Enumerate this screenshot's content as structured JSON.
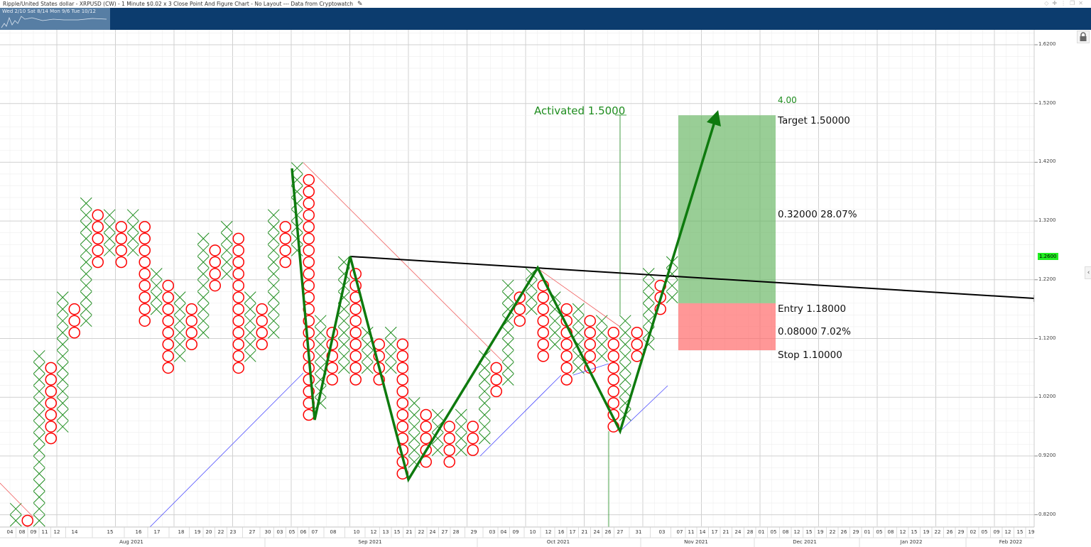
{
  "header": {
    "title": "Ripple/United States dollar - XRPUSD (CW) - 1 Minute $0.02 x 3 Close Point And Figure Chart - No Layout --- Data from Cryptowatch",
    "edit_icon": "pencil-icon",
    "window_icons": [
      "diamond-icon",
      "pin-icon",
      "info-icon",
      "restore-icon",
      "close-icon"
    ]
  },
  "navigator": {
    "dates": "Wed 2/10  Sat 8/14  Mon 9/6  Tue 10/12"
  },
  "colors": {
    "x_color": "#1e8c1e",
    "o_color": "#ff0000",
    "trend_color": "#0e7a0e",
    "target_fill": "#62b35e",
    "stop_fill": "#ff6b6b",
    "last_price_bg": "#22ee22"
  },
  "annotations": {
    "activated": "Activated 1.5000",
    "ratio": "4.00",
    "target": "Target  1.50000",
    "reward": "0.32000  28.07%",
    "entry": "Entry  1.18000",
    "risk": "0.08000  7.02%",
    "stop": "Stop  1.10000"
  },
  "last_price": "1.2600",
  "chart_data": {
    "type": "scatter",
    "subtype": "point_and_figure",
    "title": "XRPUSD $0.02 x 3 Close Point And Figure",
    "box_size": 0.02,
    "ylim": [
      0.8,
      1.66
    ],
    "y_ticks": [
      "1.6200",
      "1.5200",
      "1.4200",
      "1.3200",
      "1.2200",
      "1.1200",
      "1.0200",
      "0.9200",
      "0.8200"
    ],
    "y_tick_values": [
      1.62,
      1.52,
      1.42,
      1.32,
      1.22,
      1.12,
      1.02,
      0.92,
      0.82
    ],
    "columns": [
      {
        "t": "X",
        "lo": 0.8,
        "hi": 0.82
      },
      {
        "t": "O",
        "lo": 0.78,
        "hi": 0.8
      },
      {
        "t": "X",
        "lo": 0.78,
        "hi": 1.08
      },
      {
        "t": "O",
        "lo": 0.94,
        "hi": 1.06
      },
      {
        "t": "X",
        "lo": 0.96,
        "hi": 1.18
      },
      {
        "t": "O",
        "lo": 1.12,
        "hi": 1.16
      },
      {
        "t": "X",
        "lo": 1.14,
        "hi": 1.34
      },
      {
        "t": "O",
        "lo": 1.24,
        "hi": 1.32
      },
      {
        "t": "X",
        "lo": 1.26,
        "hi": 1.32
      },
      {
        "t": "O",
        "lo": 1.24,
        "hi": 1.3
      },
      {
        "t": "X",
        "lo": 1.26,
        "hi": 1.32
      },
      {
        "t": "O",
        "lo": 1.14,
        "hi": 1.3
      },
      {
        "t": "X",
        "lo": 1.16,
        "hi": 1.22
      },
      {
        "t": "O",
        "lo": 1.06,
        "hi": 1.2
      },
      {
        "t": "X",
        "lo": 1.08,
        "hi": 1.18
      },
      {
        "t": "O",
        "lo": 1.1,
        "hi": 1.16
      },
      {
        "t": "X",
        "lo": 1.12,
        "hi": 1.28
      },
      {
        "t": "O",
        "lo": 1.2,
        "hi": 1.26
      },
      {
        "t": "X",
        "lo": 1.22,
        "hi": 1.3
      },
      {
        "t": "O",
        "lo": 1.06,
        "hi": 1.28
      },
      {
        "t": "X",
        "lo": 1.08,
        "hi": 1.18
      },
      {
        "t": "O",
        "lo": 1.1,
        "hi": 1.16
      },
      {
        "t": "X",
        "lo": 1.12,
        "hi": 1.32
      },
      {
        "t": "O",
        "lo": 1.24,
        "hi": 1.3
      },
      {
        "t": "X",
        "lo": 1.26,
        "hi": 1.4
      },
      {
        "t": "O",
        "lo": 0.98,
        "hi": 1.38
      },
      {
        "t": "X",
        "lo": 1.0,
        "hi": 1.14
      },
      {
        "t": "O",
        "lo": 1.04,
        "hi": 1.12
      },
      {
        "t": "X",
        "lo": 1.06,
        "hi": 1.24
      },
      {
        "t": "O",
        "lo": 1.04,
        "hi": 1.22
      },
      {
        "t": "X",
        "lo": 1.06,
        "hi": 1.12
      },
      {
        "t": "O",
        "lo": 1.04,
        "hi": 1.1
      },
      {
        "t": "X",
        "lo": 1.06,
        "hi": 1.12
      },
      {
        "t": "O",
        "lo": 0.88,
        "hi": 1.1
      },
      {
        "t": "X",
        "lo": 0.9,
        "hi": 1.0
      },
      {
        "t": "O",
        "lo": 0.9,
        "hi": 0.98
      },
      {
        "t": "X",
        "lo": 0.92,
        "hi": 0.98
      },
      {
        "t": "O",
        "lo": 0.9,
        "hi": 0.96
      },
      {
        "t": "X",
        "lo": 0.92,
        "hi": 0.98
      },
      {
        "t": "O",
        "lo": 0.92,
        "hi": 0.96
      },
      {
        "t": "X",
        "lo": 0.94,
        "hi": 1.08
      },
      {
        "t": "O",
        "lo": 1.02,
        "hi": 1.06
      },
      {
        "t": "X",
        "lo": 1.04,
        "hi": 1.2
      },
      {
        "t": "O",
        "lo": 1.14,
        "hi": 1.18
      },
      {
        "t": "X",
        "lo": 1.16,
        "hi": 1.22
      },
      {
        "t": "O",
        "lo": 1.08,
        "hi": 1.2
      },
      {
        "t": "X",
        "lo": 1.1,
        "hi": 1.18
      },
      {
        "t": "O",
        "lo": 1.04,
        "hi": 1.16
      },
      {
        "t": "X",
        "lo": 1.06,
        "hi": 1.16
      },
      {
        "t": "O",
        "lo": 1.06,
        "hi": 1.14
      },
      {
        "t": "X",
        "lo": 1.08,
        "hi": 1.14
      },
      {
        "t": "O",
        "lo": 0.96,
        "hi": 1.12
      },
      {
        "t": "X",
        "lo": 0.98,
        "hi": 1.14
      },
      {
        "t": "O",
        "lo": 1.08,
        "hi": 1.12
      },
      {
        "t": "X",
        "lo": 1.1,
        "hi": 1.22
      },
      {
        "t": "O",
        "lo": 1.16,
        "hi": 1.2
      },
      {
        "t": "X",
        "lo": 1.18,
        "hi": 1.24
      }
    ],
    "trade": {
      "entry": 1.18,
      "target": 1.5,
      "stop": 1.1,
      "activated": 1.5
    },
    "x_day_labels": [
      "04",
      "08",
      "09",
      "11",
      "12",
      "14",
      "15",
      "16",
      "17",
      "18",
      "19",
      "20",
      "22",
      "23",
      "27",
      "30",
      "03",
      "05",
      "06",
      "07",
      "08",
      "10",
      "12",
      "13",
      "15",
      "21",
      "22",
      "24",
      "27",
      "28",
      "29",
      "03",
      "04",
      "09",
      "10",
      "12",
      "16",
      "17",
      "21",
      "24",
      "26",
      "27",
      "31",
      "03",
      "07",
      "11",
      "14",
      "17",
      "21",
      "24",
      "28",
      "01",
      "05",
      "08",
      "12",
      "15",
      "19",
      "22",
      "26",
      "29",
      "01",
      "05",
      "08",
      "12",
      "15",
      "19",
      "22",
      "26",
      "29",
      "02",
      "05",
      "09",
      "12",
      "15",
      "19"
    ],
    "x_month_labels": [
      "Aug 2021",
      "Sep 2021",
      "Oct 2021",
      "Nov 2021",
      "Dec 2021",
      "Jan 2022",
      "Feb 2022"
    ],
    "grid": true
  }
}
